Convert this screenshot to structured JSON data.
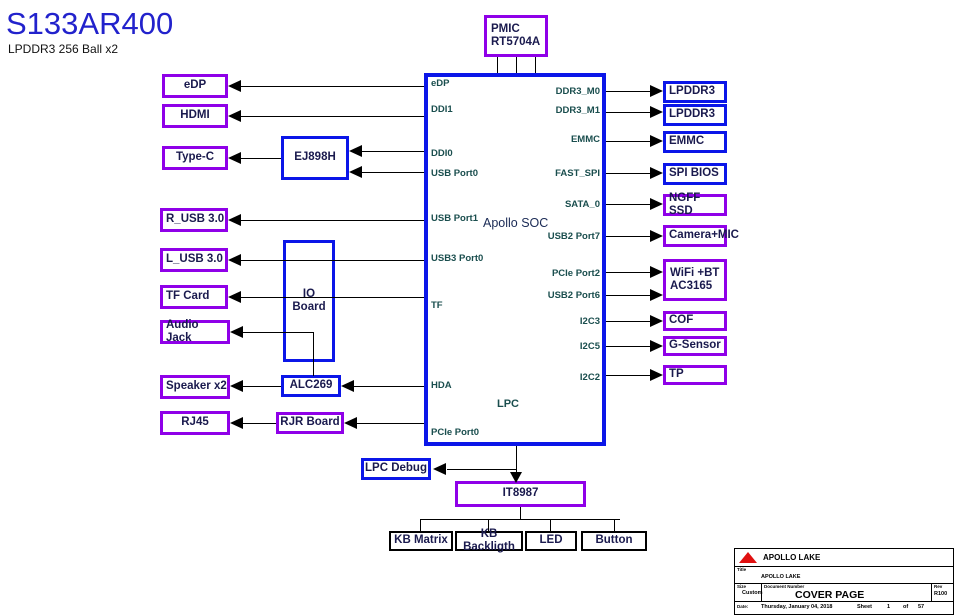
{
  "header": {
    "title": "S133AR400",
    "subtitle": "LPDDR3 256 Ball x2",
    "title_color": "#2222cc"
  },
  "colors": {
    "purple_block": "#8f00e8",
    "blue_block": "#0b16e8",
    "black_block": "#000000",
    "pin_label": "#1a4e4e",
    "soc_label": "#1a2a55",
    "wire": "#000000",
    "logo_red": "#e01010"
  },
  "soc": {
    "name": "Apollo SOC",
    "internal_label": "LPC",
    "left_pins": [
      {
        "label": "eDP"
      },
      {
        "label": "DDI1"
      },
      {
        "label": "DDI0"
      },
      {
        "label": "USB Port0"
      },
      {
        "label": "USB Port1"
      },
      {
        "label": "USB3 Port0"
      },
      {
        "label": "TF"
      },
      {
        "label": "HDA"
      },
      {
        "label": "PCIe Port0"
      }
    ],
    "right_pins": [
      {
        "label": "DDR3_M0"
      },
      {
        "label": "DDR3_M1"
      },
      {
        "label": "EMMC"
      },
      {
        "label": "FAST_SPI"
      },
      {
        "label": "SATA_0"
      },
      {
        "label": "USB2 Port7"
      },
      {
        "label": "PCIe Port2"
      },
      {
        "label": "USB2 Port6"
      },
      {
        "label": "I2C3"
      },
      {
        "label": "I2C5"
      },
      {
        "label": "I2C2"
      }
    ]
  },
  "blocks": {
    "pmic": {
      "label": "PMIC\nRT5704A",
      "line1": "PMIC",
      "line2": "RT5704A",
      "style": "purple"
    },
    "left_column": [
      {
        "label": "eDP",
        "style": "purple"
      },
      {
        "label": "HDMI",
        "style": "purple"
      },
      {
        "label": "Type-C",
        "style": "purple"
      },
      {
        "label": "R_USB 3.0",
        "style": "purple"
      },
      {
        "label": "L_USB 3.0",
        "style": "purple"
      },
      {
        "label": "TF Card",
        "style": "purple"
      },
      {
        "label": "Audio Jack",
        "style": "purple"
      },
      {
        "label": "Speaker x2",
        "style": "purple"
      },
      {
        "label": "RJ45",
        "style": "purple"
      }
    ],
    "left_mid": [
      {
        "label": "EJ898H",
        "style": "blue"
      },
      {
        "label": "IO Board",
        "style": "blue"
      },
      {
        "label": "ALC269",
        "style": "blue"
      },
      {
        "label": "RJR Board",
        "style": "purple"
      }
    ],
    "right_column": [
      {
        "label": "LPDDR3",
        "style": "blue"
      },
      {
        "label": "LPDDR3",
        "style": "blue"
      },
      {
        "label": "EMMC",
        "style": "blue"
      },
      {
        "label": "SPI BIOS",
        "style": "blue"
      },
      {
        "label": "NGFF SSD",
        "style": "purple"
      },
      {
        "label": "Camera+MIC",
        "style": "purple"
      },
      {
        "label": "WiFi +BT AC3165",
        "line1": "WiFi +BT",
        "line2": "AC3165",
        "style": "purple"
      },
      {
        "label": "COF",
        "style": "purple"
      },
      {
        "label": "G-Sensor",
        "style": "purple"
      },
      {
        "label": "TP",
        "style": "purple"
      }
    ],
    "bottom": {
      "lpc_debug": {
        "label": "LPC Debug",
        "style": "blue"
      },
      "ec": {
        "label": "IT8987",
        "style": "purple"
      },
      "peripherals": [
        {
          "label": "KB Matrix",
          "style": "black"
        },
        {
          "label": "KB Backligth",
          "style": "black"
        },
        {
          "label": "LED",
          "style": "black"
        },
        {
          "label": "Button",
          "style": "black"
        }
      ]
    }
  },
  "title_block": {
    "brand": "APOLLO LAKE",
    "title_label": "Title",
    "title_value": "APOLLO LAKE",
    "size_label": "Size",
    "size_value": "Custom",
    "docnum_label": "Document Number",
    "docnum_value": "COVER PAGE",
    "rev_label": "Rev",
    "rev_value": "R100",
    "date_label": "Date:",
    "date_value": "Thursday, January 04, 2018",
    "sheet_label": "Sheet",
    "sheet_num": "1",
    "sheet_of": "of",
    "sheet_total": "57"
  }
}
